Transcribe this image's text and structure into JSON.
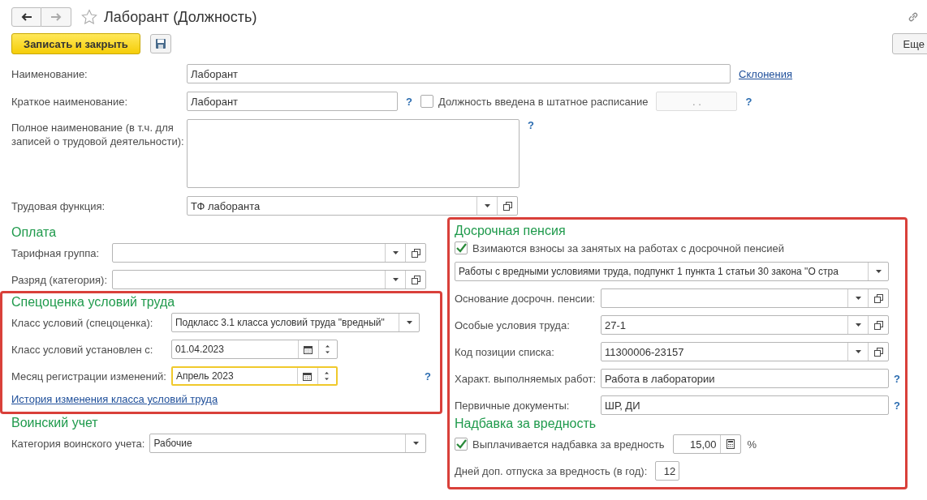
{
  "header": {
    "title": "Лаборант (Должность)"
  },
  "toolbar": {
    "save_close": "Записать и закрыть",
    "more": "Еще"
  },
  "main": {
    "name": {
      "label": "Наименование:",
      "value": "Лаборант",
      "link": "Склонения"
    },
    "short_name": {
      "label": "Краткое наименование:",
      "value": "Лаборант",
      "help": "?",
      "staff_checkbox": {
        "label": "Должность введена в штатное расписание",
        "checked": false
      },
      "staff_date": {
        "placeholder": ".  .",
        "disabled": true
      },
      "date_help": "?"
    },
    "full_name": {
      "label": "Полное наименование (в т.ч. для записей о трудовой деятельности):",
      "help": "?"
    },
    "labor_function": {
      "label": "Трудовая функция:",
      "value": "ТФ лаборанта"
    }
  },
  "columns": [
    {
      "groups": [
        {
          "framed": false,
          "sections": [
            {
              "title": "Оплата",
              "items": [
                {
                  "kind": "select",
                  "label": "Тарифная группа:"
                },
                {
                  "kind": "select",
                  "label": "Разряд (категория):"
                }
              ]
            }
          ]
        },
        {
          "framed": true,
          "sections": [
            {
              "title": "Спецоценка условий труда",
              "items": [
                {
                  "kind": "combo",
                  "label": "Класс условий (спецоценка):",
                  "value": "Подкласс 3.1 класса условий труда \"вредный\""
                },
                {
                  "kind": "date",
                  "label": "Класс условий установлен с:",
                  "value": "01.04.2023",
                  "focused": false
                },
                {
                  "kind": "date",
                  "label": "Месяц регистрации изменений:",
                  "value": "Апрель 2023",
                  "focused": true,
                  "help": "?"
                },
                {
                  "kind": "link",
                  "label": "История изменения класса условий труда"
                }
              ]
            }
          ]
        },
        {
          "framed": false,
          "sections": [
            {
              "title": "Воинский учет",
              "items": [
                {
                  "kind": "combo",
                  "label": "Категория воинского учета:",
                  "value": "Рабочие"
                }
              ]
            }
          ]
        }
      ]
    },
    {
      "groups": [
        {
          "framed": true,
          "sections": [
            {
              "title": "Досрочная пенсия",
              "items": [
                {
                  "kind": "checkbox",
                  "label": "Взимаются взносы за занятых на работах с досрочной пенсией",
                  "checked": true
                },
                {
                  "kind": "wide_combo",
                  "value": "Работы с вредными условиями труда, подпункт 1 пункта 1 статьи 30 закона \"О стра"
                },
                {
                  "kind": "select",
                  "label": "Основание досрочн. пенсии:"
                },
                {
                  "kind": "select",
                  "label": "Особые условия труда:",
                  "value": "27-1"
                },
                {
                  "kind": "select",
                  "label": "Код позиции списка:",
                  "value": "11300006-23157"
                },
                {
                  "kind": "text",
                  "label": "Характ. выполняемых работ:",
                  "value": "Работа в лаборатории",
                  "help": "?"
                },
                {
                  "kind": "text",
                  "label": "Первичные документы:",
                  "value": "ШР, ДИ",
                  "help": "?"
                }
              ]
            },
            {
              "title": "Надбавка за вредность",
              "items": [
                {
                  "kind": "percent",
                  "label": "Выплачивается надбавка за вредность",
                  "checked": true,
                  "value": "15,00",
                  "unit": "%"
                },
                {
                  "kind": "number",
                  "label": "Дней доп. отпуска за вредность (в год):",
                  "value": "12"
                }
              ]
            }
          ]
        }
      ]
    }
  ]
}
